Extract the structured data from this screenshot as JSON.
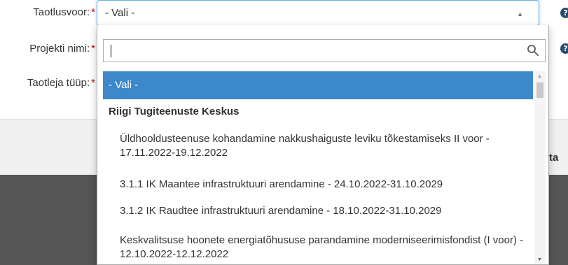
{
  "form": {
    "fields": [
      {
        "label": "Taotlusvoor:",
        "required_mark": "*"
      },
      {
        "label": "Projekti nimi:",
        "required_mark": "*"
      },
      {
        "label": "Taotleja tüüp:",
        "required_mark": "*"
      }
    ],
    "select_value": "- Vali -",
    "help_glyph": "?",
    "cut_off_text": "ta"
  },
  "dropdown": {
    "search_value": "",
    "options": {
      "selected": "- Vali -",
      "group": "Riigi Tugiteenuste Keskus",
      "items": [
        "Üldhooldusteenuse kohandamine nakkushaiguste leviku tõkestamiseks II voor - 17.11.2022-19.12.2022",
        "3.1.1 IK Maantee infrastruktuuri arendamine - 24.10.2022-31.10.2029",
        "3.1.2 IK Raudtee infrastruktuuri arendamine - 18.10.2022-31.10.2029",
        "Keskvalitsuse hoonete energiatõhususe parandamine moderniseerimisfondist (I voor) - 12.10.2022-12.12.2022"
      ]
    }
  },
  "colors": {
    "accent": "#3d87cb",
    "required": "#cc0000",
    "help_icon": "#2a4d70",
    "dark_band": "#555555"
  },
  "icons": [
    "help-icon",
    "search-icon",
    "chevron-up-icon",
    "scroll-up-icon",
    "scroll-down-icon"
  ]
}
